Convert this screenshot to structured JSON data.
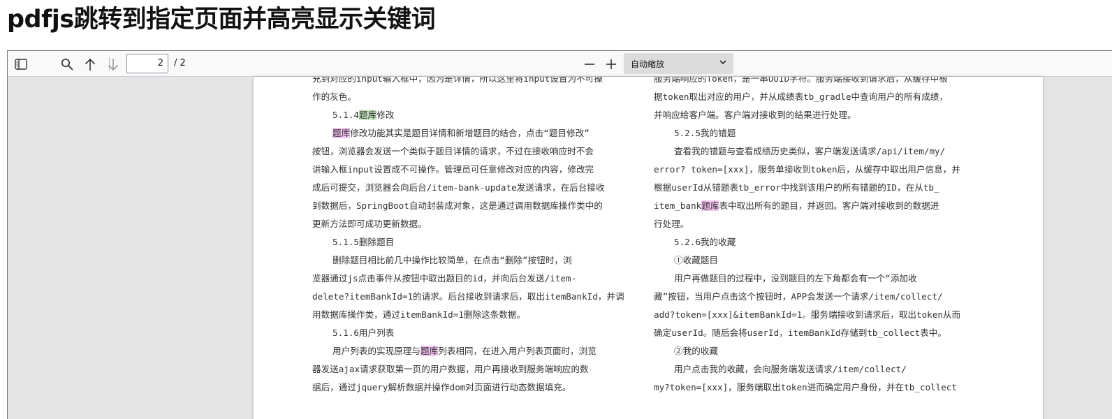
{
  "page": {
    "title": "pdfjs跳转到指定页面并高亮显示关键词"
  },
  "toolbar": {
    "sidebar_icon": "sidebar-toggle-icon",
    "search_icon": "search-icon",
    "prev_icon": "arrow-up-icon",
    "next_icon": "arrow-down-icon",
    "page_number": "2",
    "page_total": "/ 2",
    "zoom_out_icon": "minus-icon",
    "zoom_in_icon": "plus-icon",
    "zoom_value": "自动缩放"
  },
  "document": {
    "highlight_term": "题库",
    "left": {
      "l1": "充到对应的input输入框中，因为是详情，所以这里将input设置为不可操",
      "l2": "作的灰色。",
      "h514_pre": "5.1.4",
      "h514_post": "修改",
      "p514_1_post": "修改功能其实是题目详情和新增题目的结合，点击“题目修改”",
      "p514_2": "按钮，浏览器会发送一个类似于题目详情的请求，不过在接收响应时不会",
      "p514_3": "讲输入框input设置成不可操作。管理员可任意修改对应的内容，修改完",
      "p514_4": "成后可提交，浏览器会向后台/item-bank-update发送请求，在后台接收",
      "p514_5": "到数据后，SpringBoot自动封装成对象，这是通过调用数据库操作类中的",
      "p514_6": "更新方法即可成功更新数据。",
      "h515": "5.1.5删除题目",
      "p515_1": "删除题目相比前几中操作比较简单，在点击“删除”按钮时，浏",
      "p515_2": "览器通过js点击事件从按钮中取出题目的id，并向后台发送/item-",
      "p515_3": "delete?itemBankId=1的请求。后台接收到请求后，取出itemBankId，并调",
      "p515_4": "用数据库操作类，通过itemBankId=1删除这条数据。",
      "h516": "5.1.6用户列表",
      "p516_1_pre": "用户列表的实现原理与",
      "p516_1_post": "列表相同，在进入用户列表页面时，浏览",
      "p516_2": "器发送ajax请求获取第一页的用户数据，用户再接收到服务端响应的数",
      "p516_3": "据后，通过jquery解析数据并操作dom对页面进行动态数据填充。"
    },
    "right": {
      "r1": "服务端响应的Token，是一串UUID字符。服务端接收到请求后，从缓存中根",
      "r2": "据token取出对应的用户，并从成绩表tb_gradle中查询用户的所有成绩，",
      "r3": "并响应给客户端。客户端对接收到的结果进行处理。",
      "h525": "5.2.5我的错题",
      "p525_1": "查看我的错题与查看成绩历史类似，客户端发送请求/api/item/my/",
      "p525_2": "error? token=[xxx]，服务单接收到token后，从缓存中取出用户信息，并",
      "p525_3": "根据userId从错题表tb_error中找到该用户的所有错题的ID，在从tb_",
      "p525_4_pre": "item_bank",
      "p525_4_post": "表中取出所有的题目，并返回。客户端对接收到的数据进",
      "p525_5": "行处理。",
      "h526": "5.2.6我的收藏",
      "h526_1": "①收藏题目",
      "p526_1": "用户再做题目的过程中，没到题目的左下角都会有一个“添加收",
      "p526_2": "藏”按钮，当用户点击这个按钮时，APP会发送一个请求/item/collect/",
      "p526_3": "add?token=[xxx]&itemBankId=1。服务端接收到请求后，取出token从而",
      "p526_4": "确定userId。随后会将userId，itemBankId存储到tb_collect表中。",
      "h526_2": "②我的收藏",
      "p526_5": "用户点击我的收藏，会向服务端发送请求/item/collect/",
      "p526_6": "my?token=[xxx]，服务端取出token进而确定用户身份，并在tb_collect"
    }
  }
}
